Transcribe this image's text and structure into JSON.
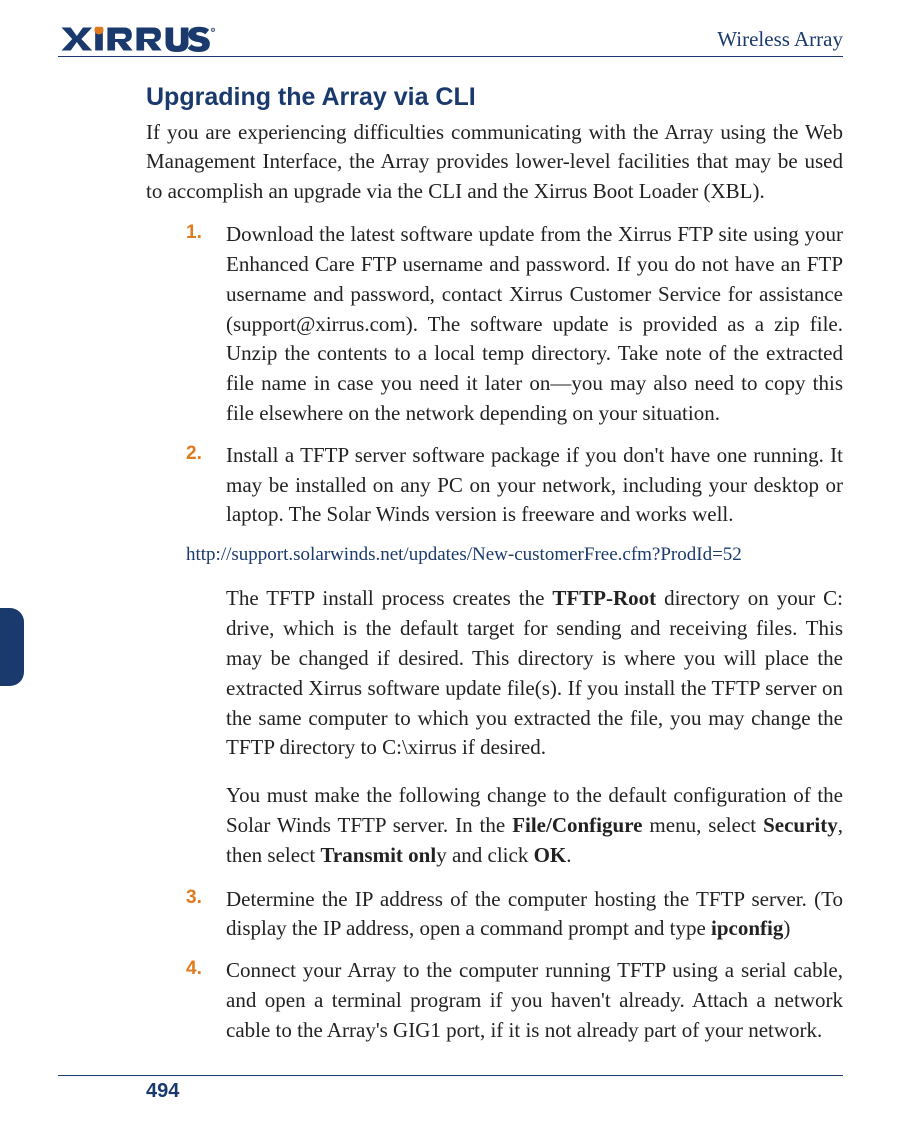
{
  "header": {
    "brand": "XIRRUS",
    "right": "Wireless Array"
  },
  "title": "Upgrading the Array via CLI",
  "intro": "If you are experiencing difficulties communicating with the Array using the Web Management Interface, the Array provides lower-level facilities that may be used to accomplish an upgrade via the CLI and the Xirrus Boot Loader (XBL).",
  "steps": {
    "n1": "1.",
    "t1": "Download the latest software update from the Xirrus FTP site using your Enhanced Care FTP username and password. If you do not have an FTP username and password, contact Xirrus Customer Service for assistance (support@xirrus.com). The software update is provided as a zip file. Unzip the contents to a local temp directory. Take note of the extracted file name in case you need it later on—you may also need to copy this file elsewhere on the network depending on your situation.",
    "n2": "2.",
    "t2": "Install a TFTP server software package if you don't have one running. It may be installed on any PC on your network, including your desktop or laptop. The Solar Winds version is freeware and works well.",
    "link": "http://support.solarwinds.net/updates/New-customerFree.cfm?ProdId=52",
    "t2b_pre": "The TFTP install process creates the ",
    "t2b_bold1": "TFTP-Root",
    "t2b_post": " directory on your C: drive, which is the default target for sending and receiving files. This may be changed if desired. This directory is where you will place the extracted Xirrus software update file(s). If you install the TFTP server on the same computer to which you extracted the file, you may change the TFTP directory to C:\\xirrus if desired.",
    "t2c_pre": "You must make the following change to the default configuration of the Solar Winds TFTP server. In the ",
    "t2c_b1": "File/Configure",
    "t2c_mid1": " menu, select ",
    "t2c_b2": "Security",
    "t2c_mid2": ", then select ",
    "t2c_b3": "Transmit onl",
    "t2c_mid3": "y and click ",
    "t2c_b4": "OK",
    "t2c_end": ".",
    "n3": "3.",
    "t3_pre": "Determine the IP address of the computer hosting the TFTP server. (To display the IP address, open a command prompt and type ",
    "t3_b": "ipconfig",
    "t3_post": ")",
    "n4": "4.",
    "t4": "Connect your Array to the computer running TFTP using a serial cable, and open a terminal program if you haven't already. Attach a network cable to the Array's GIG1 port, if it is not already part of your network."
  },
  "page_number": "494"
}
